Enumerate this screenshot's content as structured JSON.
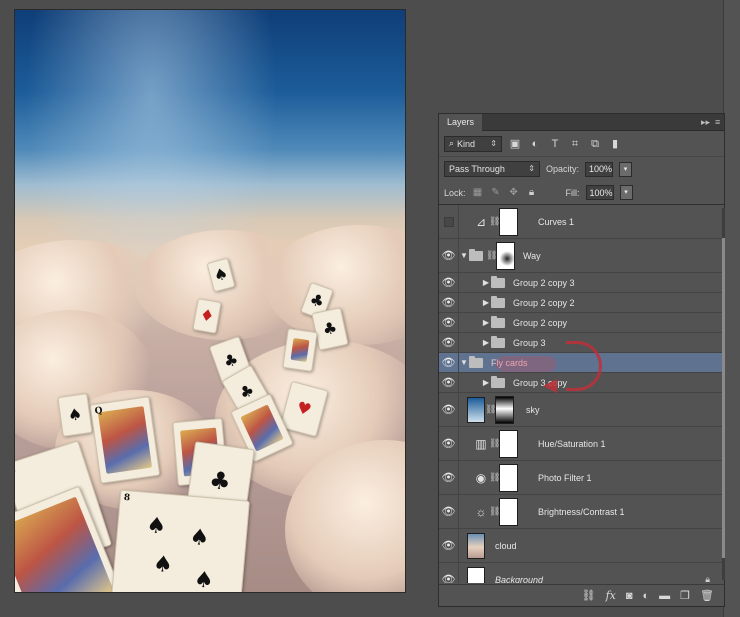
{
  "panel": {
    "tab_label": "Layers",
    "collapse_glyph": "▸▸",
    "menu_glyph": "≡"
  },
  "filter": {
    "kind_label": "Kind",
    "kind_icon": "search-icon"
  },
  "blend": {
    "mode": "Pass Through",
    "opacity_label": "Opacity:",
    "opacity_value": "100%"
  },
  "lock": {
    "lock_label": "Lock:",
    "fill_label": "Fill:",
    "fill_value": "100%"
  },
  "layers": [
    {
      "name": "Curves 1",
      "type": "adjustment",
      "icon": "curves-icon",
      "visible": false
    },
    {
      "name": "Way",
      "type": "group-thumb",
      "visible": true
    },
    {
      "name": "Group 2 copy 3",
      "type": "group",
      "visible": true
    },
    {
      "name": "Group 2 copy 2",
      "type": "group",
      "visible": true
    },
    {
      "name": "Group 2 copy",
      "type": "group",
      "visible": true
    },
    {
      "name": "Group 3",
      "type": "group",
      "visible": true
    },
    {
      "name": "Fly cards",
      "type": "group-open",
      "visible": true,
      "selected": true
    },
    {
      "name": "Group 3 copy",
      "type": "group",
      "visible": true
    },
    {
      "name": "sky",
      "type": "image-mask",
      "visible": true
    },
    {
      "name": "Hue/Saturation 1",
      "type": "adjustment",
      "icon": "hue-saturation-icon",
      "visible": true
    },
    {
      "name": "Photo Filter 1",
      "type": "adjustment",
      "icon": "photo-filter-icon",
      "visible": true
    },
    {
      "name": "Brightness/Contrast 1",
      "type": "adjustment",
      "icon": "brightness-contrast-icon",
      "visible": true
    },
    {
      "name": "cloud",
      "type": "image",
      "visible": true
    },
    {
      "name": "Background",
      "type": "image",
      "visible": true,
      "locked": true
    }
  ],
  "colors": {
    "panel_bg": "#535353",
    "selected_row": "#5f7390",
    "annotation_red": "#c0303a"
  }
}
